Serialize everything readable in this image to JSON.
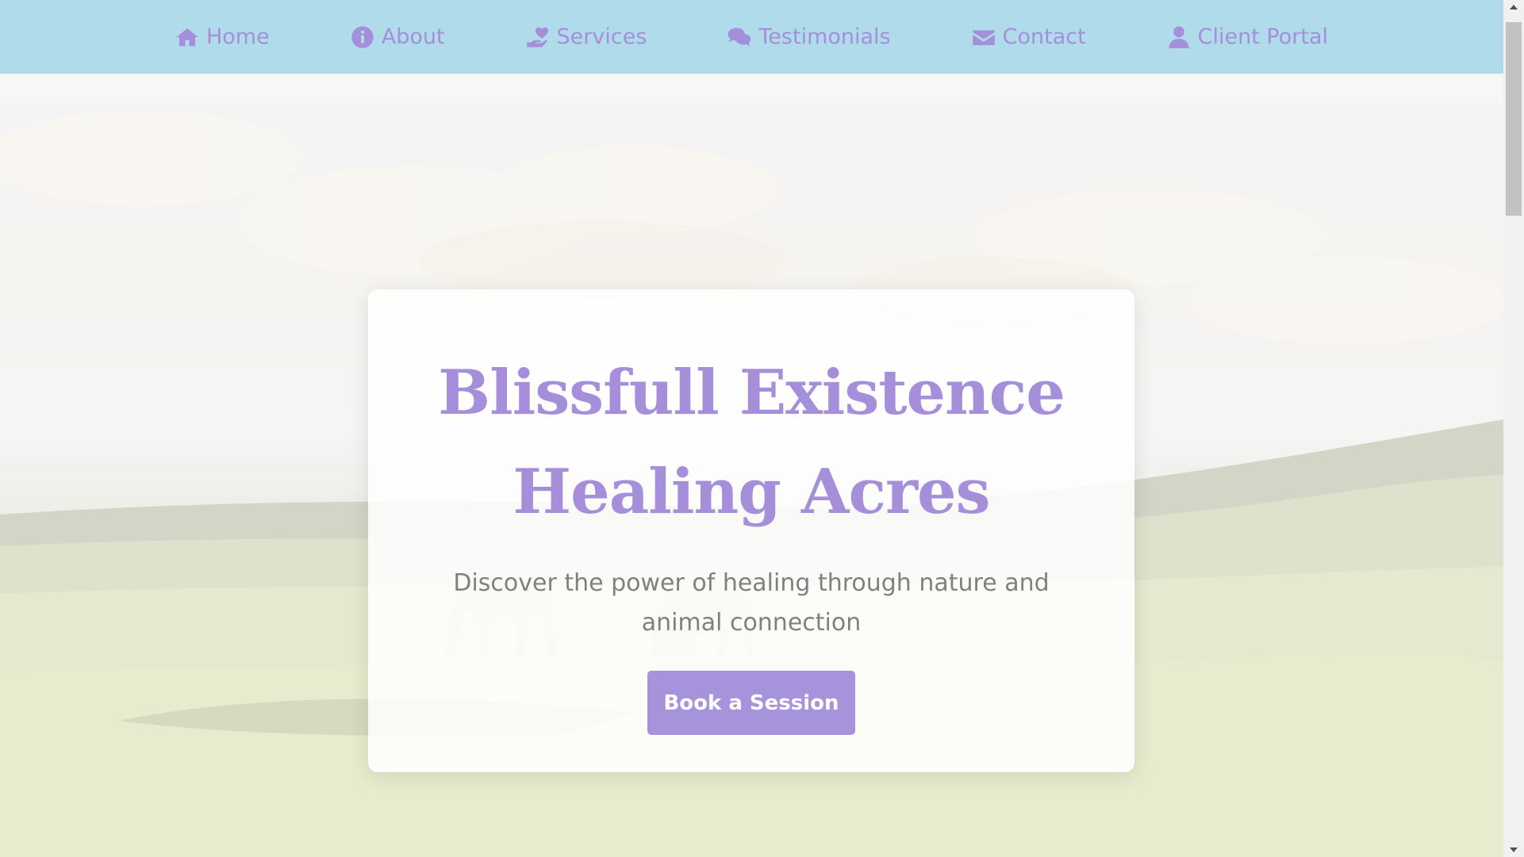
{
  "nav": {
    "items": [
      {
        "label": "Home",
        "icon": "home-icon"
      },
      {
        "label": "About",
        "icon": "info-icon"
      },
      {
        "label": "Services",
        "icon": "hand-holding-heart-icon"
      },
      {
        "label": "Testimonials",
        "icon": "comments-icon"
      },
      {
        "label": "Contact",
        "icon": "envelope-icon"
      },
      {
        "label": "Client Portal",
        "icon": "user-icon"
      }
    ]
  },
  "hero": {
    "title_line1": "Blissfull Existence",
    "title_line2": "Healing Acres",
    "subtitle": "Discover the power of healing through nature and animal connection",
    "cta_label": "Book a Session"
  },
  "colors": {
    "nav_background": "#b0dbea",
    "accent": "#a58fdb",
    "button": "#a793db"
  }
}
